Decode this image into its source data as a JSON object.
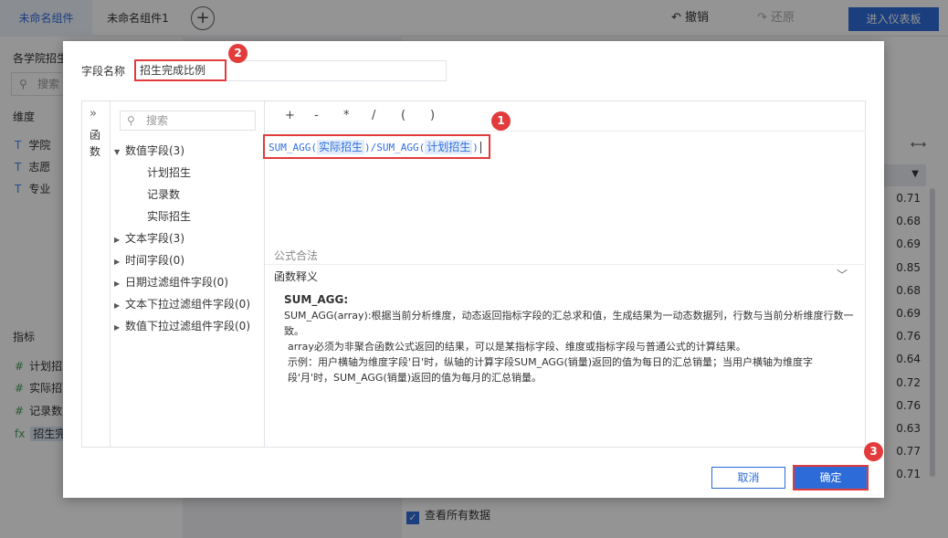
{
  "topbar": {
    "tabs": [
      "未命名组件",
      "未命名组件1"
    ],
    "add_tab": "+",
    "undo_label": "撤销",
    "redo_label": "还原",
    "enter_dashboard": "进入仪表板"
  },
  "left_panel": {
    "title": "各学院招生",
    "search_placeholder": "搜索",
    "dimensions_title": "维度",
    "dimensions": [
      "学院",
      "志愿",
      "专业"
    ],
    "metrics_title": "指标",
    "metrics": [
      "计划招",
      "实际招",
      "记录数",
      "招生完"
    ]
  },
  "table": {
    "values": [
      "0.71",
      "0.68",
      "0.69",
      "0.85",
      "0.68",
      "0.69",
      "0.76",
      "0.64",
      "0.72",
      "0.76",
      "0.63",
      "0.77",
      "0.71"
    ]
  },
  "bottom": {
    "view_all_label": "查看所有数据"
  },
  "dialog": {
    "field_name_label": "字段名称",
    "field_name_value": "招生完成比例",
    "side_label": [
      "函",
      "数"
    ],
    "tree_search_placeholder": "搜索",
    "tree": {
      "numeric": "数值字段(3)",
      "numeric_children": [
        "计划招生",
        "记录数",
        "实际招生"
      ],
      "text": "文本字段(3)",
      "time": "时间字段(0)",
      "date_filter": "日期过滤组件字段(0)",
      "text_filter": "文本下拉过滤组件字段(0)",
      "num_filter": "数值下拉过滤组件字段(0)"
    },
    "operators": [
      "+",
      "-",
      "*",
      "/",
      "(",
      ")"
    ],
    "formula": {
      "fn1": "SUM_AGG(",
      "field1": "实际招生",
      "mid": ")/SUM_AGG(",
      "field2": "计划招生",
      "end": ")"
    },
    "validity": "公式合法",
    "explain_title": "函数释义",
    "explain": {
      "name": "SUM_AGG:",
      "line1": "SUM_AGG(array):根据当前分析维度，动态返回指标字段的汇总求和值，生成结果为一动态数据列，行数与当前分析维度行数一致。",
      "line2": "array必须为非聚合函数公式返回的结果，可以是某指标字段、维度或指标字段与普通公式的计算结果。",
      "line3": "示例：用户横轴为维度字段'日'时，纵轴的计算字段SUM_AGG(销量)返回的值为每日的汇总销量；当用户横轴为维度字段'月'时，SUM_AGG(销量)返回的值为每月的汇总销量。"
    },
    "cancel_label": "取消",
    "confirm_label": "确定"
  },
  "annotations": [
    "1",
    "2",
    "3"
  ],
  "colors": {
    "accent": "#2d6bd9",
    "highlight": "#e23b3b"
  }
}
